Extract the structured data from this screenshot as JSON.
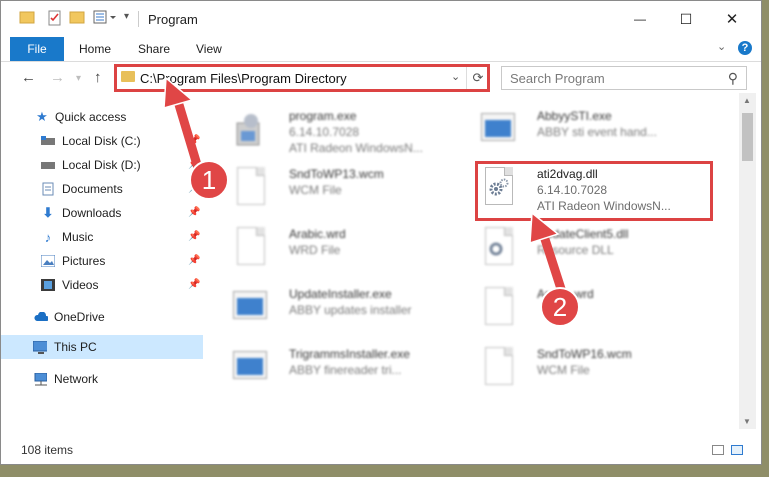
{
  "window": {
    "title": "Program",
    "controls": {
      "minimize": "—",
      "maximize": "☐",
      "close": "✕"
    }
  },
  "ribbon": {
    "file_tab": "File",
    "tabs": [
      "Home",
      "Share",
      "View"
    ],
    "help_label": "?"
  },
  "address": {
    "path": "C:\\Program Files\\Program Directory",
    "search_placeholder": "Search Program"
  },
  "sidebar": {
    "items": [
      {
        "label": "Quick access",
        "icon": "star-icon",
        "pinned": false
      },
      {
        "label": "Local Disk (C:)",
        "icon": "drive-icon",
        "pinned": true
      },
      {
        "label": "Local Disk (D:)",
        "icon": "drive-icon",
        "pinned": true
      },
      {
        "label": "Documents",
        "icon": "documents-icon",
        "pinned": true
      },
      {
        "label": "Downloads",
        "icon": "download-icon",
        "pinned": true
      },
      {
        "label": "Music",
        "icon": "music-icon",
        "pinned": true
      },
      {
        "label": "Pictures",
        "icon": "pictures-icon",
        "pinned": true
      },
      {
        "label": "Videos",
        "icon": "videos-icon",
        "pinned": true
      },
      {
        "label": "OneDrive",
        "icon": "cloud-icon",
        "pinned": false
      },
      {
        "label": "This PC",
        "icon": "computer-icon",
        "pinned": false,
        "selected": true
      },
      {
        "label": "Network",
        "icon": "network-icon",
        "pinned": false
      }
    ]
  },
  "files": [
    {
      "name": "program.exe",
      "line2": "6.14.10.7028",
      "line3": "ATI Radeon WindowsN...",
      "icon": "exe-icon",
      "blurred": true
    },
    {
      "name": "AbbyySTI.exe",
      "line2": "ABBY sti event hand...",
      "line3": "",
      "icon": "app-icon",
      "blurred": true
    },
    {
      "name": "SndToWP13.wcm",
      "line2": "WCM File",
      "line3": "",
      "icon": "document-icon",
      "blurred": true
    },
    {
      "name": "ati2dvag.dll",
      "line2": "6.14.10.7028",
      "line3": "ATI Radeon WindowsN...",
      "icon": "dll-gear-icon",
      "blurred": false
    },
    {
      "name": "Arabic.wrd",
      "line2": "WRD File",
      "line3": "",
      "icon": "document-icon",
      "blurred": true
    },
    {
      "name": "UpdateClient5.dll",
      "line2": "Resource DLL",
      "line3": "",
      "icon": "dll-gear-icon",
      "blurred": true
    },
    {
      "name": "UpdateInstaller.exe",
      "line2": "ABBY updates installer",
      "line3": "",
      "icon": "app-icon",
      "blurred": true
    },
    {
      "name": "Arabic.wrd",
      "line2": "",
      "line3": "",
      "icon": "document-icon",
      "blurred": true
    },
    {
      "name": "TrigrammsInstaller.exe",
      "line2": "ABBY finereader tri...",
      "line3": "",
      "icon": "app-icon",
      "blurred": true
    },
    {
      "name": "SndToWP16.wcm",
      "line2": "WCM File",
      "line3": "",
      "icon": "document-icon",
      "blurred": true
    }
  ],
  "status": {
    "item_count": "108 items"
  },
  "annotations": {
    "callout_1": "1",
    "callout_2": "2",
    "color": "#e04646"
  },
  "colors": {
    "accent": "#1979ca",
    "selected": "#cce8ff",
    "highlight": "#dc4343"
  }
}
